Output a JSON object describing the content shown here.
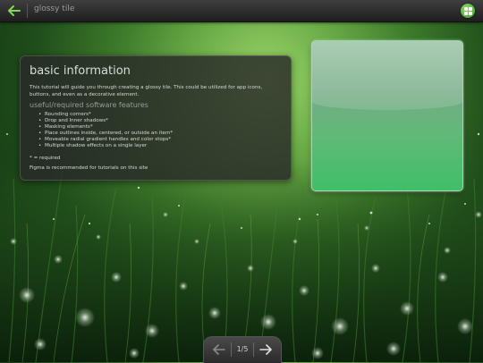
{
  "header": {
    "title": "glossy tile"
  },
  "info": {
    "title": "basic information",
    "description": "This tutorial will guide you through creating a glossy tile. This could be utilized for app icons, buttons, and even as a decorative element.",
    "subtitle": "useful/required software features",
    "features": [
      "Rounding corners*",
      "Drop and Inner shadows*",
      "Masking elements*",
      "Place outlines inside, centered, or outside an item*",
      "Moveable radial gradient handles and color stops*",
      "Multiple shadow effects on a single layer"
    ],
    "required_note": "* = required",
    "recommendation": "Figma is recommended for tutorials on this site"
  },
  "pager": {
    "label": "1/5",
    "current": 1,
    "total": 5
  },
  "colors": {
    "accent": "#4fa83a",
    "tile_bottom": "#3fbf68",
    "tile_top": "#7fb08c"
  },
  "icons": {
    "back": "left-arrow-icon",
    "menu": "grid-icon",
    "prev": "left-arrow-icon",
    "next": "right-arrow-icon"
  }
}
